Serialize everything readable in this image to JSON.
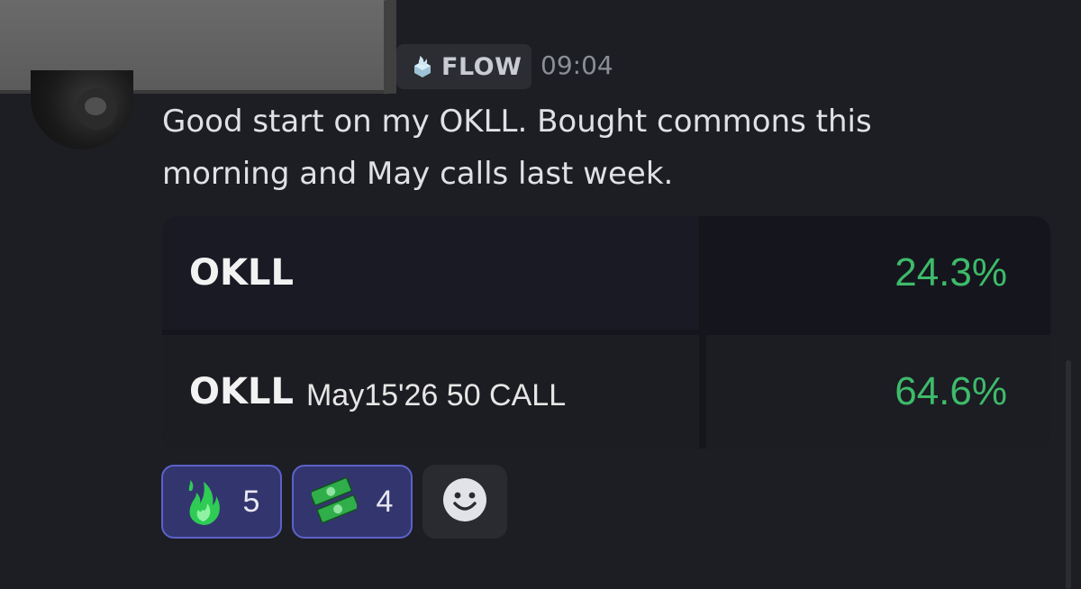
{
  "message": {
    "role_badge": {
      "label": "FLOW",
      "icon": "flame-gem-icon"
    },
    "timestamp": "09:04",
    "text_line1": "Good start on my OKLL. Bought commons this",
    "text_line2": "morning and May calls last week."
  },
  "positions": [
    {
      "ticker": "OKLL",
      "contract": "",
      "change": "24.3%"
    },
    {
      "ticker": "OKLL",
      "contract": "May15'26 50 CALL",
      "change": "64.6%"
    }
  ],
  "reactions": [
    {
      "emoji": "green-flame-icon",
      "count": "5"
    },
    {
      "emoji": "money-stack-icon",
      "count": "4"
    }
  ],
  "add_reaction_icon": "smiley-icon",
  "colors": {
    "background": "#1d1e23",
    "gain_green": "#3dbb6a",
    "reaction_active_bg": "#33366e",
    "reaction_active_border": "#5b62c9"
  }
}
